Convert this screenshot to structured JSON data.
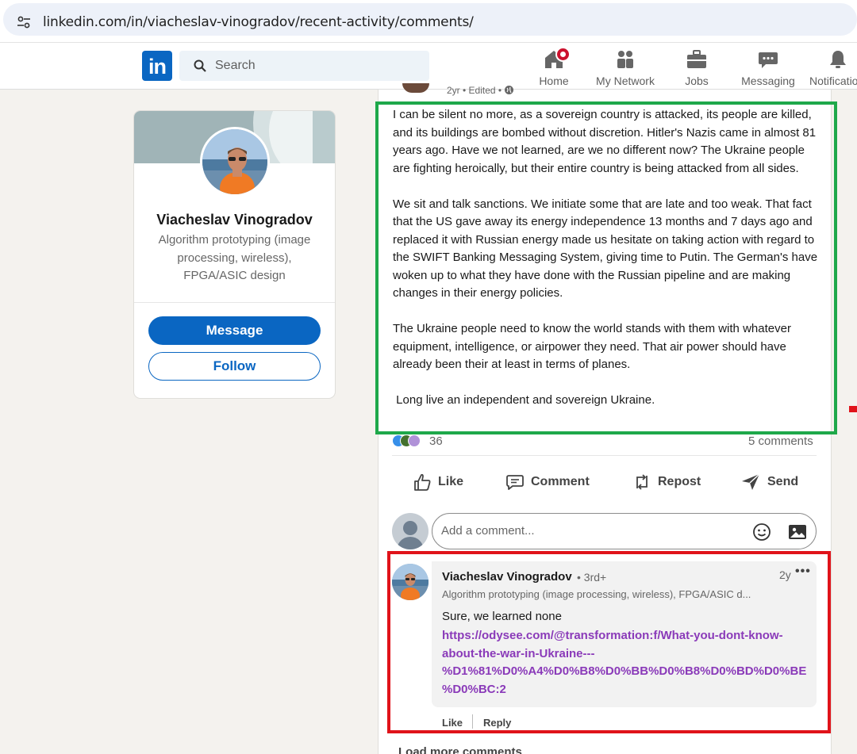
{
  "browser": {
    "url": "linkedin.com/in/viacheslav-vinogradov/recent-activity/comments/",
    "tune_icon": "tune-icon"
  },
  "header": {
    "logo_text": "in",
    "search_placeholder": "Search",
    "nav": [
      {
        "label": "Home",
        "icon": "home-icon"
      },
      {
        "label": "My Network",
        "icon": "network-icon"
      },
      {
        "label": "Jobs",
        "icon": "briefcase-icon"
      },
      {
        "label": "Messaging",
        "icon": "messaging-icon"
      },
      {
        "label": "Notificatio",
        "icon": "bell-icon"
      }
    ]
  },
  "profile": {
    "name": "Viacheslav Vinogradov",
    "headline": "Algorithm prototyping (image processing, wireless), FPGA/ASIC design",
    "message_label": "Message",
    "follow_label": "Follow"
  },
  "post": {
    "meta": "2yr • Edited • ",
    "paragraphs": [
      "I can be silent no more, as a sovereign country is attacked, its people are killed, and its buildings are bombed without discretion. Hitler's Nazis came in almost 81 years ago. Have we not learned, are we no different now? The Ukraine people are fighting heroically, but their entire country is being attacked from all sides.",
      "We sit and talk sanctions. We initiate some that are late and too weak. That fact that the US gave away its energy independence 13 months and 7 days ago and replaced it with Russian energy made us hesitate on taking action with regard to the SWIFT Banking Messaging System, giving time to Putin. The German's have woken up to what they have done with the Russian pipeline and are making changes in their energy policies.",
      "The Ukraine people need to know the world stands with them with whatever equipment, intelligence, or airpower they need. That air power should have already been their at least in terms of planes.",
      " Long live an independent and sovereign Ukraine."
    ],
    "reaction_count": "36",
    "comments_count": "5 comments",
    "actions": {
      "like": "Like",
      "comment": "Comment",
      "repost": "Repost",
      "send": "Send"
    },
    "comment_placeholder": "Add a comment...",
    "load_more": "Load more comments"
  },
  "comment": {
    "author": "Viacheslav Vinogradov",
    "degree": "• 3rd+",
    "time": "2y",
    "more": "•••",
    "headline": "Algorithm prototyping (image processing, wireless), FPGA/ASIC d...",
    "text": "Sure, we learned none",
    "link_lines": [
      "https://odysee.com/@transformation:f/What-you-dont-know-",
      "about-the-war-in-Ukraine---",
      "%D1%81%D0%A4%D0%B8%D0%BB%D0%B8%D0%BD%D0%BE",
      "%D0%BC:2"
    ],
    "like_label": "Like",
    "reply_label": "Reply"
  },
  "colors": {
    "linkedin_blue": "#0a66c2",
    "highlight_green": "#1ea84a",
    "highlight_red": "#e0131a",
    "link_purple": "#8a3ab9"
  }
}
